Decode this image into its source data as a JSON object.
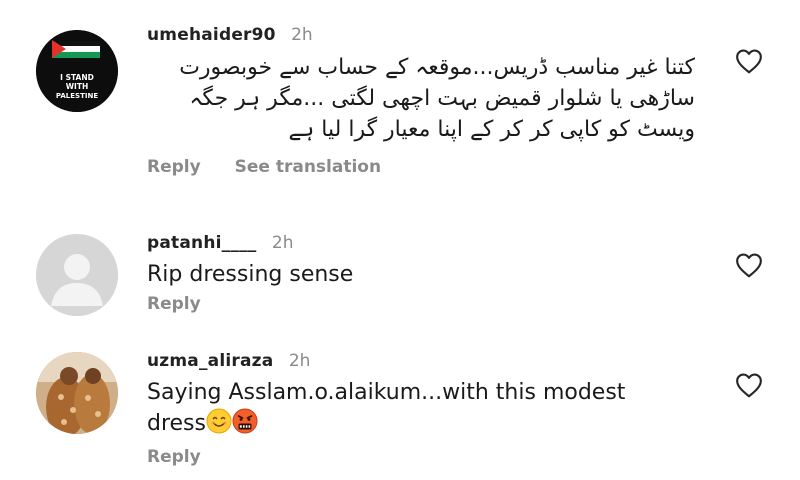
{
  "comments": [
    {
      "username": "umehaider90",
      "time": "2h",
      "text": "کتنا غیر مناسب ڈریس...موقعہ کے حساب سے خوبصورت ساڑھی یا شلوار قمیض بہت اچھی لگتی ...مگر ہر جگہ ویسٹ کو کاپی کر کر کے اپنا معیار گرا لیا ہے",
      "reply_label": "Reply",
      "translate_label": "See translation",
      "avatar_text": [
        "I STAND",
        "WITH",
        "PALESTINE"
      ]
    },
    {
      "username": "patanhi____",
      "time": "2h",
      "text": "Rip dressing sense",
      "reply_label": "Reply"
    },
    {
      "username": "uzma_aliraza",
      "time": "2h",
      "text": "Saying Asslam.o.alaikum...with this modest dress",
      "reply_label": "Reply"
    }
  ],
  "icons": {
    "like": "heart-outline-icon",
    "emoji_1": "smiling-face-icon",
    "emoji_2": "face-with-symbols-on-mouth-icon"
  },
  "colors": {
    "meta_gray": "#8a8a8a",
    "text": "#1a1a1a"
  }
}
